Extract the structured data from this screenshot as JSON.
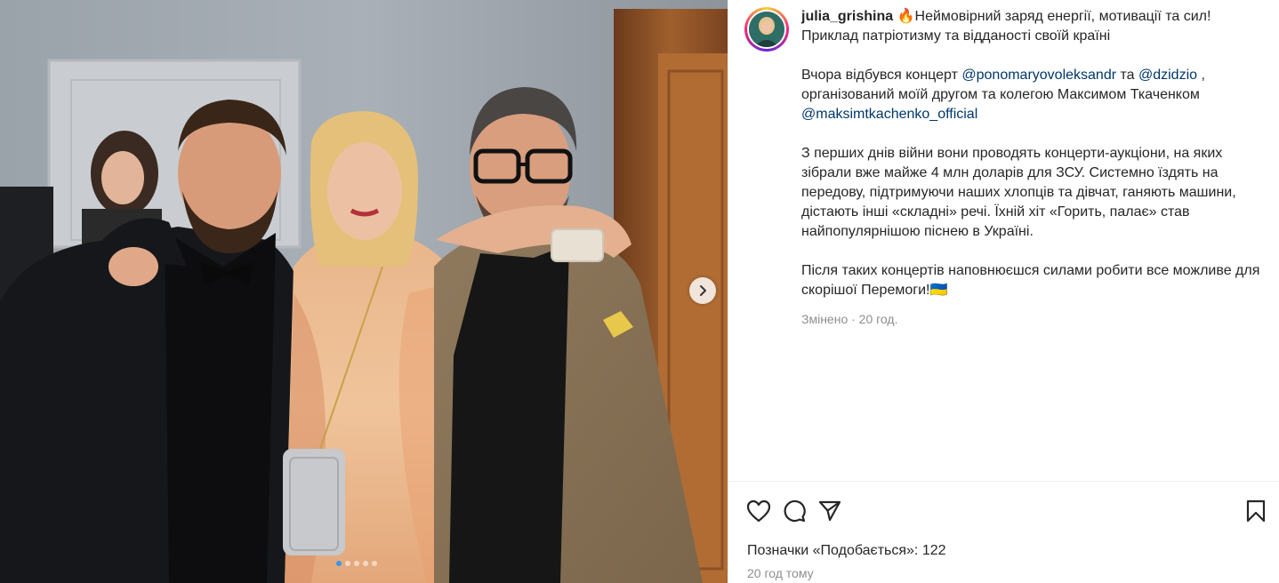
{
  "post": {
    "username": "julia_grishina",
    "caption_lines": [
      "🔥Неймовірний заряд енергії, мотивації та сил!",
      "Приклад патріотизму та відданості своїй країні"
    ],
    "paragraph2": {
      "before": "Вчора відбувся концерт ",
      "mention1": "@ponomaryovoleksandr",
      "middle": " та ",
      "mention2": "@dzidzio",
      "after": " , організований моїй другом та колегою Максимом Ткаченком ",
      "mention3": "@maksimtkachenko_official"
    },
    "paragraph3": "З перших днів війни вони проводять концерти-аукціони, на яких зібрали вже майже 4 млн доларів для ЗСУ. Системно їздять на передову, підтримуючи наших хлопців та дівчат, ганяють машини, дістають інші «складні» речі. Їхній хіт «Горить, палає» став найпопулярнішою піснею в Україні.",
    "paragraph4": "Після таких концертів наповнюєшся силами робити все можливе для скорішої Перемоги!🇺🇦",
    "edited": "Змінено · 20 год.",
    "likes_label": "Позначки «Подобається»: 122",
    "timestamp": "20 год тому"
  },
  "carousel": {
    "dots": 5,
    "active_index": 0
  },
  "icons": {
    "like": "heart-icon",
    "comment": "comment-icon",
    "share": "send-icon",
    "save": "bookmark-icon",
    "next": "chevron-right-icon"
  },
  "colors": {
    "mention": "#00376b",
    "muted": "#8e8e8e",
    "carousel_active": "#3897f0"
  }
}
